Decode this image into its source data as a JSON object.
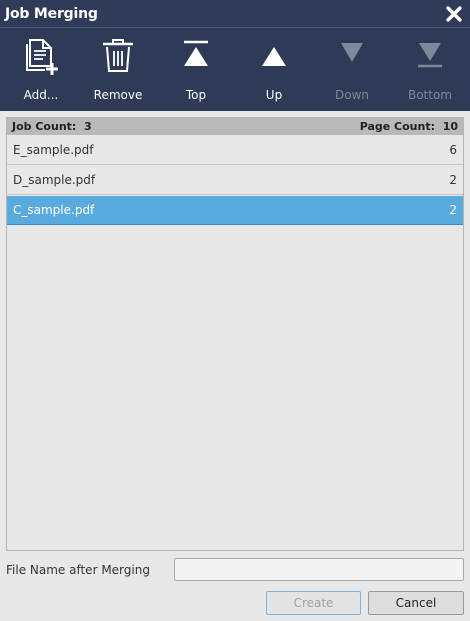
{
  "window": {
    "title": "Job Merging"
  },
  "toolbar": {
    "add_label": "Add...",
    "remove_label": "Remove",
    "top_label": "Top",
    "up_label": "Up",
    "down_label": "Down",
    "bottom_label": "Bottom",
    "icons": [
      "add-file-icon",
      "trash-icon",
      "move-top-icon",
      "move-up-icon",
      "move-down-icon",
      "move-bottom-icon"
    ]
  },
  "list": {
    "job_count_label": "Job Count:",
    "job_count": "3",
    "page_count_label": "Page Count:",
    "page_count": "10",
    "rows": [
      {
        "name": "E_sample.pdf",
        "pages": "6",
        "selected": false
      },
      {
        "name": "D_sample.pdf",
        "pages": "2",
        "selected": false
      },
      {
        "name": "C_sample.pdf",
        "pages": "2",
        "selected": true
      }
    ]
  },
  "merge": {
    "file_name_label": "File Name after Merging",
    "file_name_value": "",
    "create_label": "Create",
    "cancel_label": "Cancel"
  },
  "colors": {
    "titlebar": "#2f3b58",
    "selected_row": "#5aabdd",
    "disabled_text": "#7e879b"
  }
}
